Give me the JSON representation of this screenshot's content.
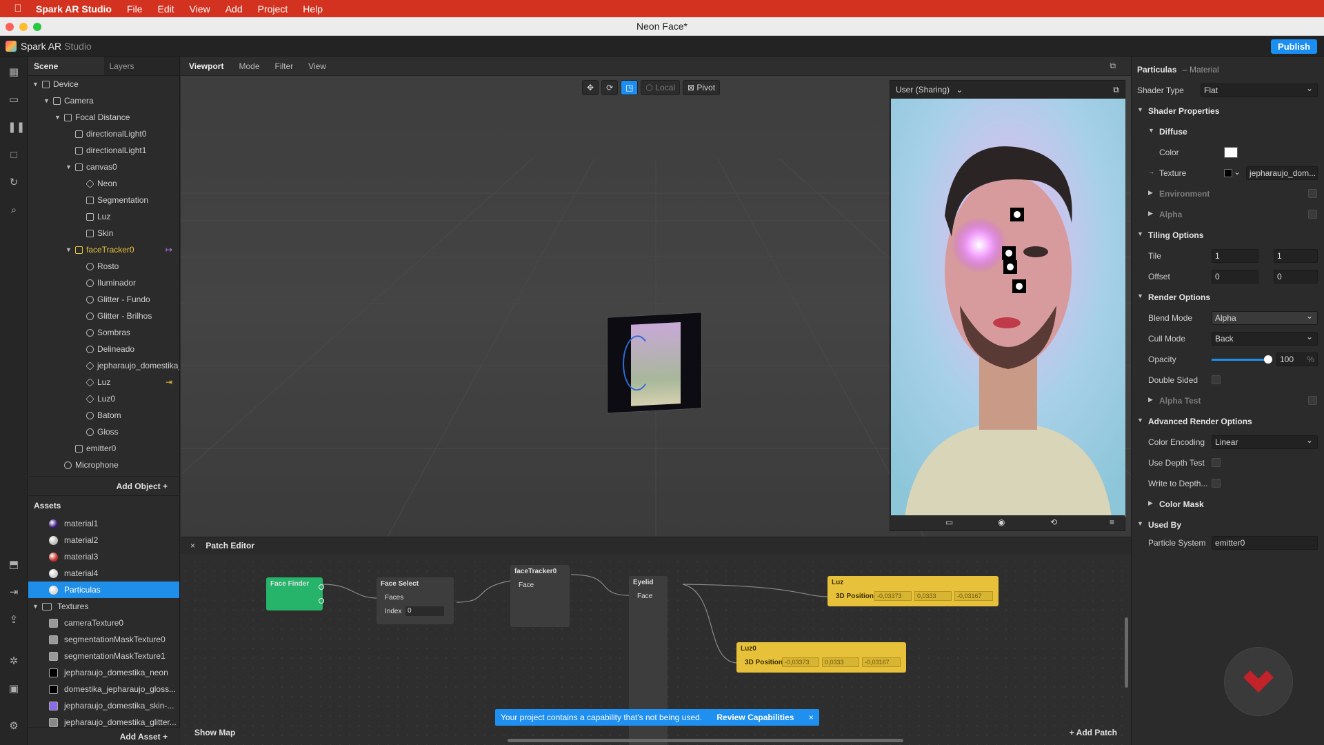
{
  "menubar": {
    "app": "Spark AR Studio",
    "items": [
      "File",
      "Edit",
      "View",
      "Add",
      "Project",
      "Help"
    ]
  },
  "window": {
    "title": "Neon Face*"
  },
  "header": {
    "brand": "Spark AR",
    "brand_suffix": "Studio",
    "publish": "Publish"
  },
  "scene_panel": {
    "tabs": [
      "Scene",
      "Layers"
    ],
    "tree": [
      {
        "label": "Device",
        "depth": 0,
        "arrow": true,
        "icon": "device-icon"
      },
      {
        "label": "Camera",
        "depth": 1,
        "arrow": true,
        "icon": "camera-icon"
      },
      {
        "label": "Focal Distance",
        "depth": 2,
        "arrow": true,
        "icon": "focal-icon"
      },
      {
        "label": "directionalLight0",
        "depth": 3,
        "icon": "light-icon"
      },
      {
        "label": "directionalLight1",
        "depth": 3,
        "icon": "light-icon"
      },
      {
        "label": "canvas0",
        "depth": 3,
        "arrow": true,
        "icon": "canvas-icon"
      },
      {
        "label": "Neon",
        "depth": 4,
        "icon": "plane-icon"
      },
      {
        "label": "Segmentation",
        "depth": 4,
        "icon": "rect-icon"
      },
      {
        "label": "Luz",
        "depth": 4,
        "icon": "rect-icon"
      },
      {
        "label": "Skin",
        "depth": 4,
        "icon": "rect-icon"
      },
      {
        "label": "faceTracker0",
        "depth": 3,
        "arrow": true,
        "icon": "face-tracker-icon",
        "yellow": true
      },
      {
        "label": "Rosto",
        "depth": 4,
        "icon": "mesh-icon"
      },
      {
        "label": "Iluminador",
        "depth": 4,
        "icon": "mesh-icon"
      },
      {
        "label": "Glitter - Fundo",
        "depth": 4,
        "icon": "mesh-icon"
      },
      {
        "label": "Glitter - Brilhos",
        "depth": 4,
        "icon": "mesh-icon"
      },
      {
        "label": "Sombras",
        "depth": 4,
        "icon": "mesh-icon"
      },
      {
        "label": "Delineado",
        "depth": 4,
        "icon": "mesh-icon"
      },
      {
        "label": "jepharaujo_domestika_...",
        "depth": 4,
        "icon": "plane-icon"
      },
      {
        "label": "Luz",
        "depth": 4,
        "icon": "plane-icon"
      },
      {
        "label": "Luz0",
        "depth": 4,
        "icon": "plane-icon"
      },
      {
        "label": "Batom",
        "depth": 4,
        "icon": "mesh-icon"
      },
      {
        "label": "Gloss",
        "depth": 4,
        "icon": "mesh-icon"
      },
      {
        "label": "emitter0",
        "depth": 3,
        "icon": "emitter-icon"
      },
      {
        "label": "Microphone",
        "depth": 2,
        "icon": "microphone-icon"
      }
    ],
    "add_object": "Add Object"
  },
  "assets_panel": {
    "title": "Assets",
    "materials": [
      {
        "label": "material1",
        "color": "#3a1a7a"
      },
      {
        "label": "material2",
        "color": "#bdbdbd"
      },
      {
        "label": "material3",
        "color": "#c8322a"
      },
      {
        "label": "material4",
        "color": "#cfcfcf"
      },
      {
        "label": "Particulas",
        "color": "#d8d8d8",
        "selected": true
      }
    ],
    "textures_label": "Textures",
    "textures": [
      {
        "label": "cameraTexture0"
      },
      {
        "label": "segmentationMaskTexture0"
      },
      {
        "label": "segmentationMaskTexture1"
      },
      {
        "label": "jepharaujo_domestika_neon"
      },
      {
        "label": "domestika_jepharaujo_gloss..."
      },
      {
        "label": "jepharaujo_domestika_skin-..."
      },
      {
        "label": "jepharaujo_domestika_glitter..."
      }
    ],
    "add_asset": "Add Asset"
  },
  "viewport": {
    "tabs": [
      "Viewport",
      "Mode",
      "Filter",
      "View"
    ],
    "local": "Local",
    "pivot": "Pivot"
  },
  "simulator": {
    "device": "User (Sharing)"
  },
  "inspector": {
    "title": "Particulas",
    "subtitle": "– Material",
    "shader_type_label": "Shader Type",
    "shader_type": "Flat",
    "shader_properties": "Shader Properties",
    "diffuse": "Diffuse",
    "color_label": "Color",
    "texture_label": "Texture",
    "texture_value": "jepharaujo_dom...",
    "environment": "Environment",
    "alpha": "Alpha",
    "tiling_options": "Tiling Options",
    "tile_label": "Tile",
    "tile": [
      "1",
      "1"
    ],
    "offset_label": "Offset",
    "offset": [
      "0",
      "0"
    ],
    "render_options": "Render Options",
    "blend_mode_label": "Blend Mode",
    "blend_mode": "Alpha",
    "cull_mode_label": "Cull Mode",
    "cull_mode": "Back",
    "opacity_label": "Opacity",
    "opacity": "100",
    "opacity_unit": "%",
    "opacity_fraction": 1.0,
    "double_sided_label": "Double Sided",
    "alpha_test": "Alpha Test",
    "advanced_render_options": "Advanced Render Options",
    "color_encoding_label": "Color Encoding",
    "color_encoding": "Linear",
    "use_depth_test_label": "Use Depth Test",
    "write_to_depth_label": "Write to Depth...",
    "color_mask": "Color Mask",
    "used_by": "Used By",
    "particle_system_label": "Particle System",
    "particle_system": "emitter0"
  },
  "patch_editor": {
    "title": "Patch Editor",
    "show_map": "Show Map",
    "add_patch": "Add Patch",
    "nodes": {
      "face_finder": "Face Finder",
      "face_select": "Face Select",
      "face_select_faces": "Faces",
      "face_select_index_label": "Index",
      "face_select_index": "0",
      "face_tracker": "faceTracker0",
      "face_tracker_face": "Face",
      "eyelid": "Eyelid",
      "eyelid_face": "Face",
      "luz": "Luz",
      "luz_port": "3D Position",
      "luz_values": [
        "-0,03373",
        "0,0333",
        "-0,03167"
      ],
      "luz0": "Luz0",
      "luz0_port": "3D Position",
      "luz0_values": [
        "-0,03373",
        "0,0333",
        "-0,03167"
      ]
    }
  },
  "banner": {
    "message": "Your project contains a capability that's not being used.",
    "action": "Review Capabilities"
  }
}
